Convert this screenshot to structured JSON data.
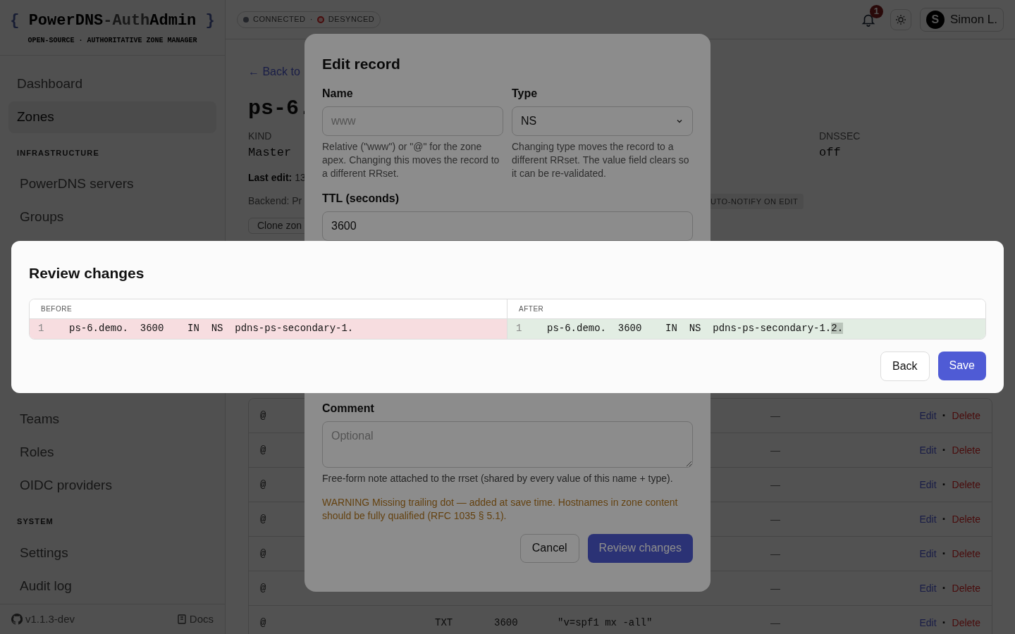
{
  "sidebar": {
    "logo": {
      "open": "{",
      "parts": [
        {
          "text": "PowerDNS",
          "kind": "strong"
        },
        {
          "text": "-Auth",
          "kind": "muted"
        },
        {
          "text": "Admin",
          "kind": "strong"
        }
      ],
      "close": "}",
      "tagline": "OPEN-SOURCE · AUTHORITATIVE ZONE MANAGER"
    },
    "sections": [
      {
        "items": [
          {
            "label": "Dashboard",
            "selected": false
          },
          {
            "label": "Zones",
            "selected": true
          }
        ]
      },
      {
        "title": "INFRASTRUCTURE",
        "items": [
          {
            "label": "PowerDNS servers",
            "selected": false
          },
          {
            "label": "Groups",
            "selected": false
          }
        ]
      },
      {
        "items": [
          {
            "label": "Teams",
            "selected": false
          },
          {
            "label": "Roles",
            "selected": false
          },
          {
            "label": "OIDC providers",
            "selected": false
          }
        ]
      },
      {
        "title": "SYSTEM",
        "items": [
          {
            "label": "Settings",
            "selected": false
          },
          {
            "label": "Audit log",
            "selected": false
          }
        ]
      }
    ],
    "footer": {
      "version": "v1.1.3-dev",
      "docs": "Docs"
    }
  },
  "header": {
    "status": [
      {
        "label": "CONNECTED",
        "kind": "connected"
      },
      {
        "label": "DESYNCED",
        "kind": "desynced"
      }
    ],
    "separator": "·",
    "notifications": "1",
    "user": {
      "initial": "S",
      "name": "Simon L."
    }
  },
  "zone": {
    "back": "← Back to",
    "title": "ps-6.",
    "kind_label": "KIND",
    "kind": "Master",
    "dnssec_label": "DNSSEC",
    "dnssec": "off",
    "last_edit_label": "Last edit:",
    "last_edit": "13",
    "backend": "Backend: Pr",
    "clone": "Clone zon",
    "tag": "UTO-NOTIFY ON EDIT"
  },
  "records": [
    {
      "name": "@",
      "comment": "—",
      "edit": "Edit",
      "separator": "·",
      "delete": "Delete"
    },
    {
      "name": "@",
      "comment": "—",
      "edit": "Edit",
      "separator": "·",
      "delete": "Delete"
    },
    {
      "name": "@",
      "comment": "—",
      "edit": "Edit",
      "separator": "·",
      "delete": "Delete"
    },
    {
      "name": "@",
      "comment": "—",
      "edit": "Edit",
      "separator": "·",
      "delete": "Delete"
    },
    {
      "name": "@",
      "comment": "—",
      "edit": "Edit",
      "separator": "·",
      "delete": "Delete"
    },
    {
      "name": "@",
      "comment": "—",
      "edit": "Edit",
      "separator": "·",
      "delete": "Delete"
    },
    {
      "name": "@",
      "type": "TXT",
      "ttl": "3600",
      "content": "\"v=spf1 mx -all\"",
      "comment": "—",
      "edit": "Edit",
      "separator": "·",
      "delete": "Delete"
    }
  ],
  "edit_dialog": {
    "title": "Edit record",
    "name_label": "Name",
    "name_placeholder": "www",
    "name_hint": "Relative (\"www\") or \"@\" for the zone apex. Changing this moves the record to a different RRset.",
    "type_label": "Type",
    "type_value": "NS",
    "type_hint": "Changing type moves the record to a different RRset. The value field clears so it can be re-validated.",
    "ttl_label": "TTL (seconds)",
    "ttl_value": "3600",
    "comment_label": "Comment",
    "comment_placeholder": "Optional",
    "comment_hint": "Free-form note attached to the rrset (shared by every value of this name + type).",
    "warning": "WARNING Missing trailing dot — added at save time. Hostnames in zone content should be fully qualified (RFC 1035 § 5.1).",
    "cancel": "Cancel",
    "review": "Review changes"
  },
  "review_dialog": {
    "title": "Review changes",
    "panes": [
      {
        "heading": "BEFORE",
        "kind": "removed",
        "lines": [
          {
            "number": "1",
            "segments": [
              {
                "text": "ps-6.demo.  3600    IN  NS  pdns-ps-secondary-1.",
                "changed": false
              }
            ]
          }
        ]
      },
      {
        "heading": "AFTER",
        "kind": "added",
        "lines": [
          {
            "number": "1",
            "segments": [
              {
                "text": "ps-6.demo.  3600    IN  NS  pdns-ps-secondary-1.",
                "changed": false
              },
              {
                "text": "2.",
                "changed": true
              }
            ]
          }
        ]
      }
    ],
    "back": "Back",
    "save": "Save"
  }
}
